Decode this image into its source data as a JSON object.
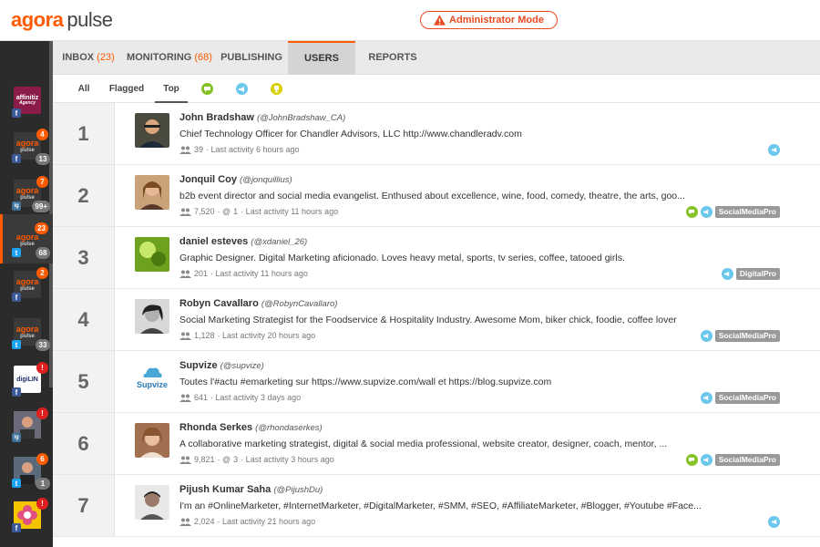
{
  "header": {
    "logo_part1": "agora",
    "logo_part2": "pulse",
    "admin_label": "Administrator Mode"
  },
  "colors": {
    "brand": "#ff5b00",
    "admin": "#e8491d",
    "twitter": "#1da1f2",
    "facebook": "#3b5998",
    "instagram": "#3f729b",
    "green_icon": "#84c225",
    "blue_icon": "#6cc7ec"
  },
  "nav": {
    "tabs": [
      {
        "label": "INBOX",
        "count": "(23)"
      },
      {
        "label": "MONITORING",
        "count": "(68)"
      },
      {
        "label": "PUBLISHING",
        "count": ""
      },
      {
        "label": "USERS",
        "count": ""
      },
      {
        "label": "REPORTS",
        "count": ""
      }
    ],
    "active": "USERS"
  },
  "filters": {
    "items": [
      "All",
      "Flagged",
      "Top"
    ],
    "active": "Top",
    "icons": [
      "chat-filter-icon",
      "megaphone-filter-icon",
      "trophy-filter-icon"
    ]
  },
  "sidebar": {
    "accounts": [
      {
        "logo_line1": "affinitiz",
        "logo_line2": "Agency",
        "network": "f",
        "badge_top": "",
        "badge_bottom": ""
      },
      {
        "logo_line1": "agora",
        "logo_line2": "pulse",
        "network": "f",
        "badge_top": "4",
        "badge_bottom": "13"
      },
      {
        "logo_line1": "agora",
        "logo_line2": "pulse",
        "network": "ig",
        "badge_top": "7",
        "badge_bottom": "99+"
      },
      {
        "logo_line1": "agora",
        "logo_line2": "pulse",
        "network": "t",
        "badge_top": "23",
        "badge_bottom": "68"
      },
      {
        "logo_line1": "agora",
        "logo_line2": "pulse",
        "network": "f",
        "badge_top": "2",
        "badge_bottom": ""
      },
      {
        "logo_line1": "agora",
        "logo_line2": "pulse",
        "network": "t",
        "badge_top": "",
        "badge_bottom": "33"
      },
      {
        "logo_line1": "digiLIN",
        "logo_line2": "",
        "network": "f",
        "badge_top": "!",
        "badge_bottom": ""
      },
      {
        "logo_line1": "",
        "logo_line2": "",
        "network": "ig",
        "badge_top": "!",
        "badge_bottom": ""
      },
      {
        "logo_line1": "",
        "logo_line2": "",
        "network": "t",
        "badge_top": "6",
        "badge_bottom": "1"
      },
      {
        "logo_line1": "",
        "logo_line2": "",
        "network": "f",
        "badge_top": "!",
        "badge_bottom": ""
      }
    ]
  },
  "users": [
    {
      "rank": "1",
      "name": "John Bradshaw",
      "handle": "(@JohnBradshaw_CA)",
      "bio": "Chief Technology Officer for Chandler Advisors, LLC http://www.chandleradv.com",
      "followers": "39",
      "mentions": "",
      "last_activity": "· Last activity 6 hours ago",
      "chat": false,
      "megaphone": true,
      "tag": ""
    },
    {
      "rank": "2",
      "name": "Jonquil Coy",
      "handle": "(@jonquillius)",
      "bio": "b2b event director and social media evangelist. Enthused about excellence, wine, food, comedy, theatre, the arts, goo...",
      "followers": "7,520",
      "mentions": "1",
      "last_activity": "· Last activity 11 hours ago",
      "chat": true,
      "megaphone": true,
      "tag": "SocialMediaPro"
    },
    {
      "rank": "3",
      "name": "daniel esteves",
      "handle": "(@xdaniel_26)",
      "bio": "Graphic Designer. Digital Marketing aficionado. Loves heavy metal, sports, tv series, coffee, tatooed girls.",
      "followers": "201",
      "mentions": "",
      "last_activity": "· Last activity 11 hours ago",
      "chat": false,
      "megaphone": true,
      "tag": "DigitalPro"
    },
    {
      "rank": "4",
      "name": "Robyn Cavallaro",
      "handle": "(@RobynCavallaro)",
      "bio": "Social Marketing Strategist for the Foodservice & Hospitality Industry. Awesome Mom, biker chick, foodie, coffee lover",
      "followers": "1,128",
      "mentions": "",
      "last_activity": "· Last activity 20 hours ago",
      "chat": false,
      "megaphone": true,
      "tag": "SocialMediaPro"
    },
    {
      "rank": "5",
      "name": "Supvize",
      "handle": "(@supvize)",
      "bio": "Toutes l'#actu #emarketing sur https://www.supvize.com/wall et https://blog.supvize.com",
      "followers": "641",
      "mentions": "",
      "last_activity": "· Last activity 3 days ago",
      "chat": false,
      "megaphone": true,
      "tag": "SocialMediaPro"
    },
    {
      "rank": "6",
      "name": "Rhonda Serkes",
      "handle": "(@rhondaserkes)",
      "bio": "A collaborative marketing strategist, digital & social media professional, website creator, designer, coach, mentor, ...",
      "followers": "9,821",
      "mentions": "3",
      "last_activity": "· Last activity 3 hours ago",
      "chat": true,
      "megaphone": true,
      "tag": "SocialMediaPro"
    },
    {
      "rank": "7",
      "name": "Pijush Kumar Saha",
      "handle": "(@PijushDu)",
      "bio": "I'm an #OnlineMarketer, #InternetMarketer, #DigitalMarketer, #SMM, #SEO, #AffiliateMarketer, #Blogger, #Youtube #Face...",
      "followers": "2,024",
      "mentions": "",
      "last_activity": "· Last activity 21 hours ago",
      "chat": false,
      "megaphone": true,
      "tag": ""
    }
  ]
}
